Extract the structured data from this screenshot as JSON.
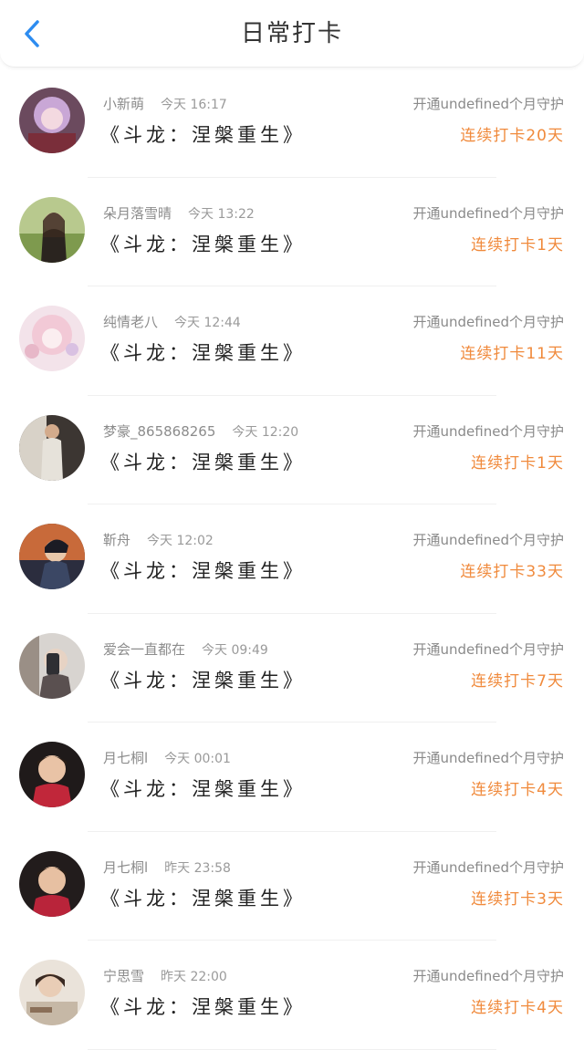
{
  "header": {
    "title": "日常打卡",
    "back_icon": "chevron-left-icon",
    "back_color": "#2d8cf0"
  },
  "colors": {
    "streak": "#f08a3c",
    "meta": "#8c8c8c"
  },
  "entries": [
    {
      "user": "小新萌",
      "time": "今天 16:17",
      "book": "《斗龙：涅槃重生》",
      "guard": "开通undefined个月守护",
      "streak": "连续打卡20天"
    },
    {
      "user": "朵月落雪晴",
      "time": "今天 13:22",
      "book": "《斗龙：涅槃重生》",
      "guard": "开通undefined个月守护",
      "streak": "连续打卡1天"
    },
    {
      "user": "纯情老八",
      "time": "今天 12:44",
      "book": "《斗龙：涅槃重生》",
      "guard": "开通undefined个月守护",
      "streak": "连续打卡11天"
    },
    {
      "user": "梦豪_865868265",
      "time": "今天 12:20",
      "book": "《斗龙：涅槃重生》",
      "guard": "开通undefined个月守护",
      "streak": "连续打卡1天"
    },
    {
      "user": "靳舟",
      "time": "今天 12:02",
      "book": "《斗龙：涅槃重生》",
      "guard": "开通undefined个月守护",
      "streak": "连续打卡33天"
    },
    {
      "user": "爱会一直都在",
      "time": "今天 09:49",
      "book": "《斗龙：涅槃重生》",
      "guard": "开通undefined个月守护",
      "streak": "连续打卡7天"
    },
    {
      "user": "月七桐l",
      "time": "今天 00:01",
      "book": "《斗龙：涅槃重生》",
      "guard": "开通undefined个月守护",
      "streak": "连续打卡4天"
    },
    {
      "user": "月七桐l",
      "time": "昨天 23:58",
      "book": "《斗龙：涅槃重生》",
      "guard": "开通undefined个月守护",
      "streak": "连续打卡3天"
    },
    {
      "user": "宁思雪",
      "time": "昨天 22:00",
      "book": "《斗龙：涅槃重生》",
      "guard": "开通undefined个月守护",
      "streak": "连续打卡4天"
    }
  ]
}
